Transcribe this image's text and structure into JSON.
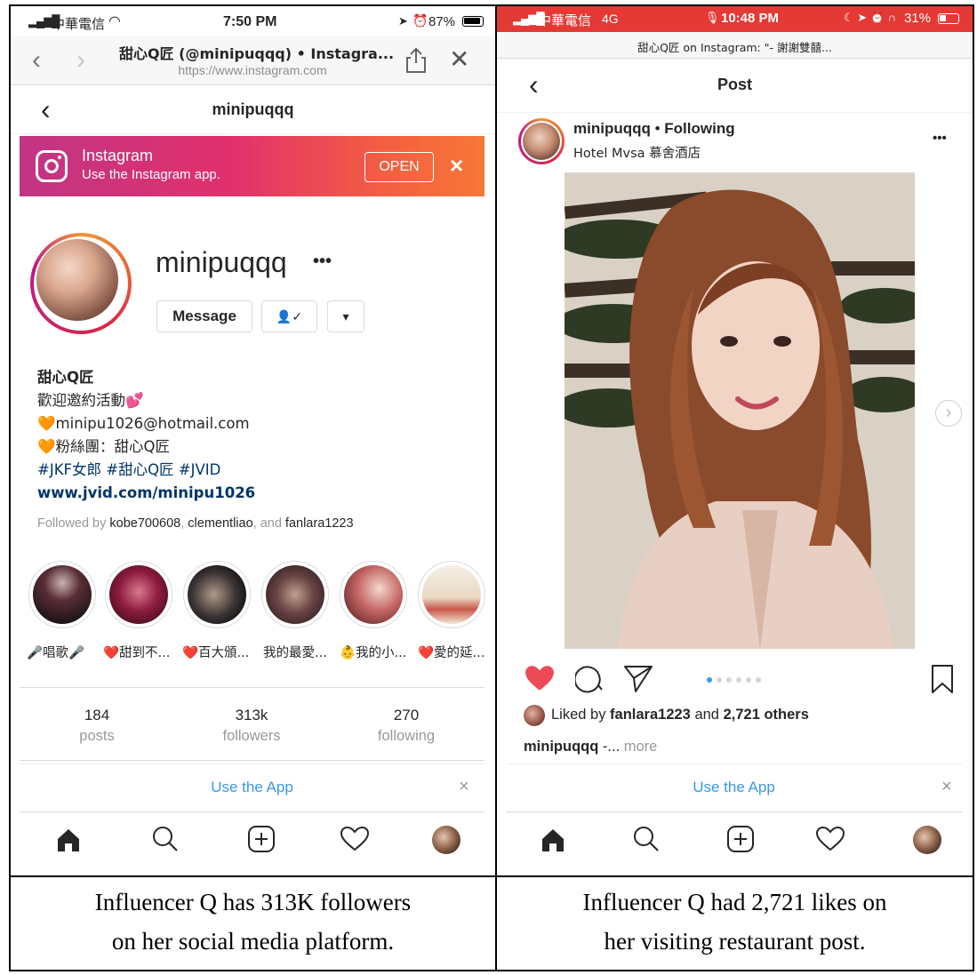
{
  "left": {
    "status": {
      "carrier": "中華電信",
      "time": "7:50 PM",
      "battery": "87%"
    },
    "safari": {
      "title": "甜心Q匠 (@minipuqqq) • Instagra...",
      "url": "https://www.instagram.com"
    },
    "nav_title": "minipuqqq",
    "banner": {
      "title": "Instagram",
      "subtitle": "Use the Instagram app.",
      "open": "OPEN",
      "close": "×"
    },
    "profile": {
      "username": "minipuqqq",
      "more": "•••",
      "message_button": "Message",
      "follow_icon": "👤✓",
      "dropdown": "▾"
    },
    "bio": {
      "name": "甜心Q匠",
      "line1": "歡迎邀約活動💕",
      "line2": "🧡minipu1026@hotmail.com",
      "line3": "🧡粉絲團：甜心Q匠",
      "tags": "#JKF女郎 #甜心Q匠 #JVID",
      "link": "www.jvid.com/minipu1026"
    },
    "followed_by": {
      "prefix": "Followed by ",
      "u1": "kobe700608",
      "sep1": ", ",
      "u2": "clementliao",
      "sep2": ", and ",
      "u3": "fanlara1223"
    },
    "highlights": [
      "🎤唱歌🎤",
      "❤️甜到不...",
      "❤️百大頒...",
      "我的最愛...",
      "👶我的小...",
      "❤️愛的延..."
    ],
    "stats": [
      {
        "num": "184",
        "label": "posts"
      },
      {
        "num": "313k",
        "label": "followers"
      },
      {
        "num": "270",
        "label": "following"
      }
    ],
    "use_app": "Use the App",
    "use_app_close": "×"
  },
  "right": {
    "status": {
      "carrier": "中華電信",
      "network": "4G",
      "time": "10:48 PM",
      "battery": "31%"
    },
    "title_bar": "甜心Q匠 on Instagram: \"- 謝謝雙囍...",
    "nav_title": "Post",
    "post": {
      "username": "minipuqqq",
      "dot": " • ",
      "following": "Following",
      "location": "Hotel Mvsa 慕舍酒店",
      "more": "•••"
    },
    "likes": {
      "prefix": "Liked by ",
      "user": "fanlara1223",
      "mid": " and ",
      "count": "2,721 others"
    },
    "caption": {
      "user": "minipuqqq",
      "rest": " -...",
      "more": " more"
    },
    "use_app": "Use the App",
    "use_app_close": "×",
    "carousel_dots": 6,
    "carousel_active": 1
  },
  "captions": {
    "left_line1": "Influencer Q has 313K followers",
    "left_line2": "on her social media platform.",
    "right_line1": "Influencer Q had 2,721 likes on",
    "right_line2": "her visiting restaurant post."
  },
  "colors": {
    "ig_link": "#003569",
    "ig_blue": "#3897f0",
    "like_red": "#ed4956",
    "banner_start": "#c13584",
    "banner_end": "#f77737",
    "status_red": "#e53935"
  }
}
